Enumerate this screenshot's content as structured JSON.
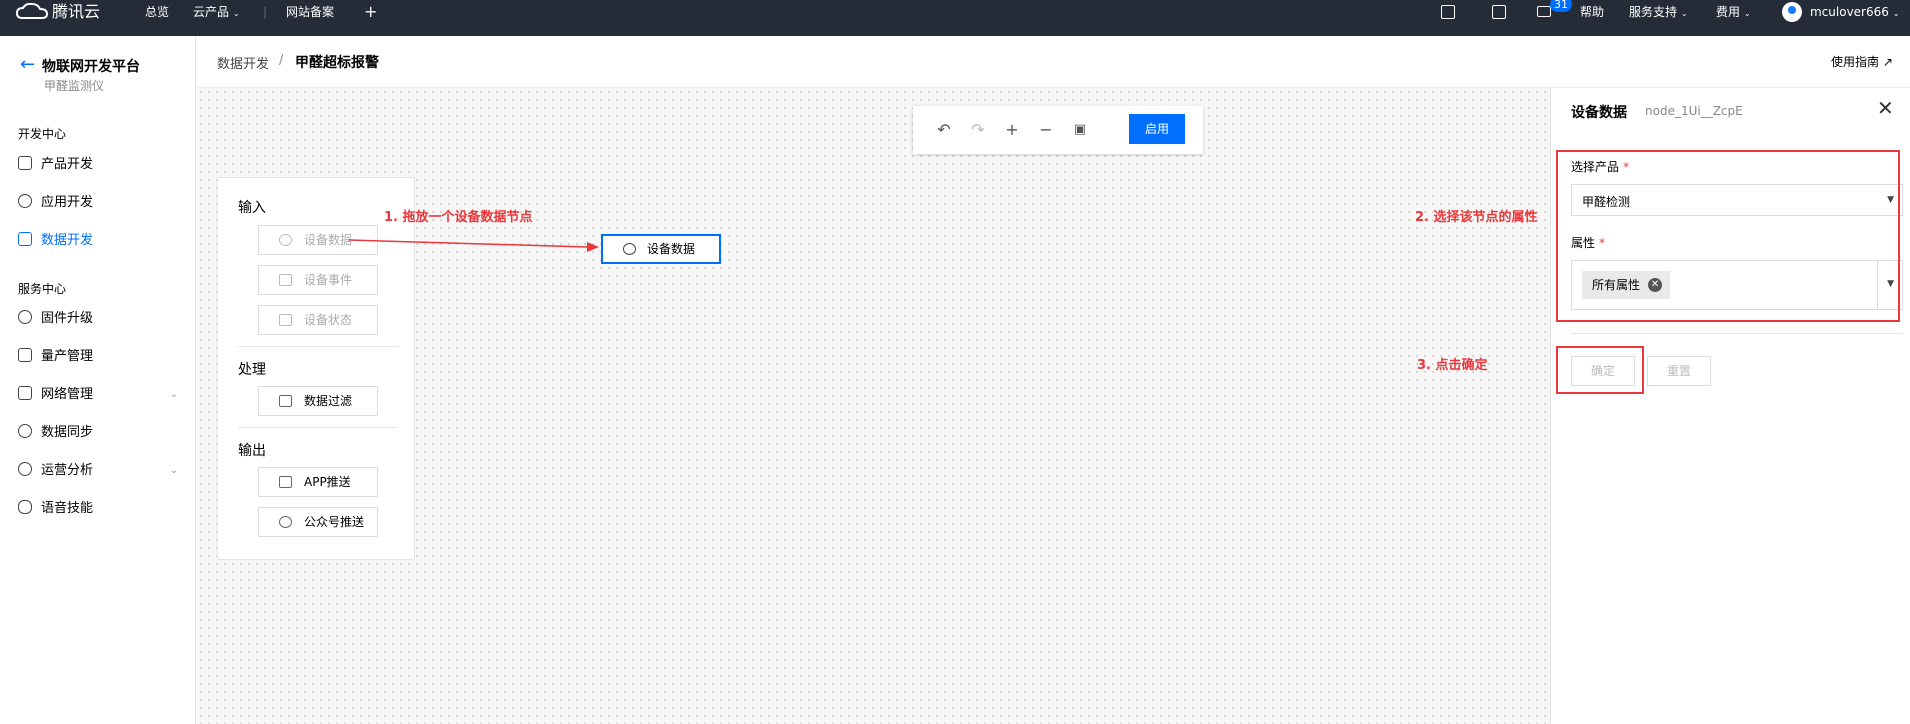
{
  "topbar": {
    "brand": "腾讯云",
    "nav": [
      "总览",
      "云产品",
      "网站备案"
    ],
    "plus": "+",
    "mail_badge": "31",
    "help": "帮助",
    "support": "服务支持",
    "billing": "费用",
    "username": "mculover666"
  },
  "sidebar": {
    "title": "物联网开发平台",
    "subtitle": "甲醛监测仪",
    "group_dev": "开发中心",
    "group_service": "服务中心",
    "items": [
      {
        "label": "产品开发",
        "icon": "chip-icon"
      },
      {
        "label": "应用开发",
        "icon": "app-icon"
      },
      {
        "label": "数据开发",
        "icon": "flow-icon",
        "active": true
      },
      {
        "label": "固件升级",
        "icon": "firmware-icon"
      },
      {
        "label": "量产管理",
        "icon": "list-icon"
      },
      {
        "label": "网络管理",
        "icon": "network-icon",
        "expandable": true
      },
      {
        "label": "数据同步",
        "icon": "sync-icon"
      },
      {
        "label": "运营分析",
        "icon": "analytics-icon",
        "expandable": true
      },
      {
        "label": "语音技能",
        "icon": "voice-icon"
      }
    ]
  },
  "header": {
    "breadcrumb_parent": "数据开发",
    "breadcrumb_sep": "/",
    "breadcrumb_current": "甲醛超标报警",
    "guide": "使用指南"
  },
  "toolbar": {
    "enable_label": "启用",
    "icons": [
      "undo-icon",
      "redo-icon",
      "zoom-in-icon",
      "zoom-out-icon",
      "save-icon"
    ]
  },
  "palette": {
    "input_title": "输入",
    "input_items": [
      "设备数据",
      "设备事件",
      "设备状态"
    ],
    "process_title": "处理",
    "process_items": [
      "数据过滤"
    ],
    "output_title": "输出",
    "output_items": [
      "APP推送",
      "公众号推送"
    ]
  },
  "canvas": {
    "node_label": "设备数据"
  },
  "annotations": {
    "step1": "1. 拖放一个设备数据节点",
    "step2": "2. 选择该节点的属性",
    "step3": "3. 点击确定"
  },
  "panel": {
    "title": "设备数据",
    "node_id": "node_1Ui__ZcpE",
    "product_label": "选择产品",
    "product_value": "甲醛检测",
    "attr_label": "属性",
    "attr_tag": "所有属性",
    "required_mark": "*",
    "confirm_label": "确定",
    "reset_label": "重置"
  },
  "colors": {
    "topbar_bg": "#252c38",
    "accent": "#006eff",
    "annotation": "#e8383b"
  }
}
